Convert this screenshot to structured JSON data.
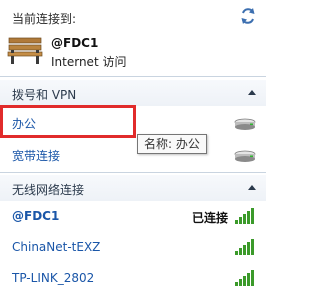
{
  "header": {
    "title": "当前连接到:",
    "refresh_icon": "refresh-icon"
  },
  "current": {
    "name": "@FDC1",
    "status": "Internet 访问",
    "icon": "bench-network-icon"
  },
  "sections": [
    {
      "label": "拨号和 VPN",
      "items": [
        {
          "name": "办公",
          "icon": "modem-icon"
        },
        {
          "name": "宽带连接",
          "icon": "modem-icon"
        }
      ]
    },
    {
      "label": "无线网络连接",
      "items": [
        {
          "name": "@FDC1",
          "state": "已连接",
          "icon": "wifi-signal-icon"
        },
        {
          "name": "ChinaNet-tEXZ",
          "state": "",
          "icon": "wifi-signal-icon"
        },
        {
          "name": "TP-LINK_2802",
          "state": "",
          "icon": "wifi-signal-icon"
        }
      ]
    }
  ],
  "tooltip": {
    "text": "名称: 办公"
  },
  "colors": {
    "link": "#1a56a8",
    "highlight": "#e12b2b",
    "signal": "#3b9a2a"
  }
}
